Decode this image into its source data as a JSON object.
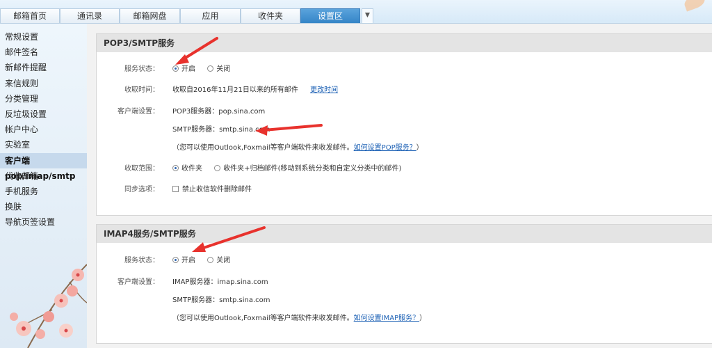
{
  "top_tabs": [
    {
      "label": "邮箱首页",
      "active": false
    },
    {
      "label": "通讯录",
      "active": false
    },
    {
      "label": "邮箱网盘",
      "active": false
    },
    {
      "label": "应用",
      "active": false
    },
    {
      "label": "收件夹",
      "active": false
    },
    {
      "label": "设置区",
      "active": true
    }
  ],
  "tab_dropdown_icon": "chevron-down-icon",
  "sidebar": {
    "items": [
      {
        "label": "常规设置"
      },
      {
        "label": "邮件签名"
      },
      {
        "label": "新邮件提醒"
      },
      {
        "label": "来信规则"
      },
      {
        "label": "分类管理"
      },
      {
        "label": "反垃圾设置"
      },
      {
        "label": "帐户中心"
      },
      {
        "label": "实验室"
      },
      {
        "label": "客户端pop/imap/smtp",
        "active": true
      },
      {
        "label": "代收邮箱"
      },
      {
        "label": "手机服务"
      },
      {
        "label": "换肤"
      },
      {
        "label": "导航页签设置"
      }
    ]
  },
  "pop3": {
    "title": "POP3/SMTP服务",
    "status_label": "服务状态：",
    "on": "开启",
    "off": "关闭",
    "receive_time_label": "收取时间：",
    "receive_time_value": "收取自2016年11月21日以来的所有邮件",
    "change_time_link": "更改时间",
    "client_label": "客户端设置：",
    "pop3_server": "POP3服务器：pop.sina.com",
    "smtp_server": "SMTP服务器：smtp.sina.com",
    "note_prefix": "（您可以使用Outlook,Foxmail等客户端软件来收发邮件。",
    "note_link": "如何设置POP服务？",
    "note_suffix": "）",
    "range_label": "收取范围：",
    "range_inbox": "收件夹",
    "range_all": "收件夹+归档邮件(移动到系统分类和自定义分类中的邮件)",
    "sync_label": "同步选项：",
    "sync_option": "禁止收信软件删除邮件"
  },
  "imap": {
    "title": "IMAP4服务/SMTP服务",
    "status_label": "服务状态：",
    "on": "开启",
    "off": "关闭",
    "client_label": "客户端设置：",
    "imap_server": "IMAP服务器：imap.sina.com",
    "smtp_server": "SMTP服务器：smtp.sina.com",
    "note_prefix": "（您可以使用Outlook,Foxmail等客户端软件来收发邮件。",
    "note_link": "如何设置IMAP服务？",
    "note_suffix": "）"
  },
  "colors": {
    "accent": "#3585c7",
    "arrow": "#e8322d",
    "link": "#1a5fb4"
  }
}
